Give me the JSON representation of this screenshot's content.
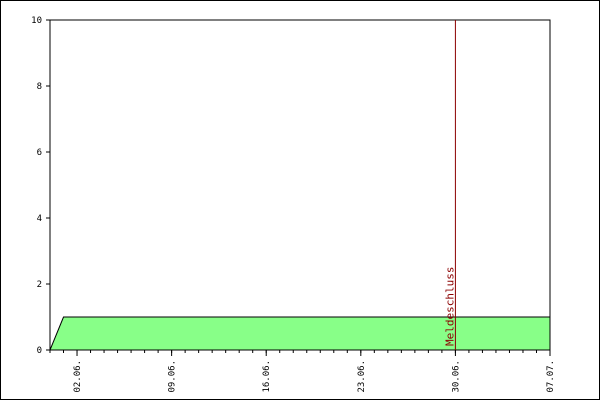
{
  "chart_data": {
    "type": "area",
    "title": "",
    "xlabel": "",
    "ylabel": "",
    "x_axis": {
      "start": "31.05.",
      "end": "07.07.",
      "tick_labels": [
        "02.06.",
        "09.06.",
        "16.06.",
        "23.06.",
        "30.06.",
        "07.07."
      ],
      "tick_days": [
        2,
        9,
        16,
        23,
        30,
        37
      ]
    },
    "y_axis": {
      "ylim": [
        0,
        10
      ],
      "tick_labels": [
        "0",
        "2",
        "4",
        "6",
        "8",
        "10"
      ],
      "tick_values": [
        0,
        2,
        4,
        6,
        8,
        10
      ]
    },
    "series": [
      {
        "x_days": [
          0,
          1,
          37
        ],
        "values": [
          0,
          1,
          1
        ],
        "fill": "#88ff88",
        "stroke": "#000000"
      }
    ],
    "marker": {
      "label": "Meldeschluss",
      "x_day": 30.0,
      "color": "#8b0000"
    },
    "grid": false
  }
}
